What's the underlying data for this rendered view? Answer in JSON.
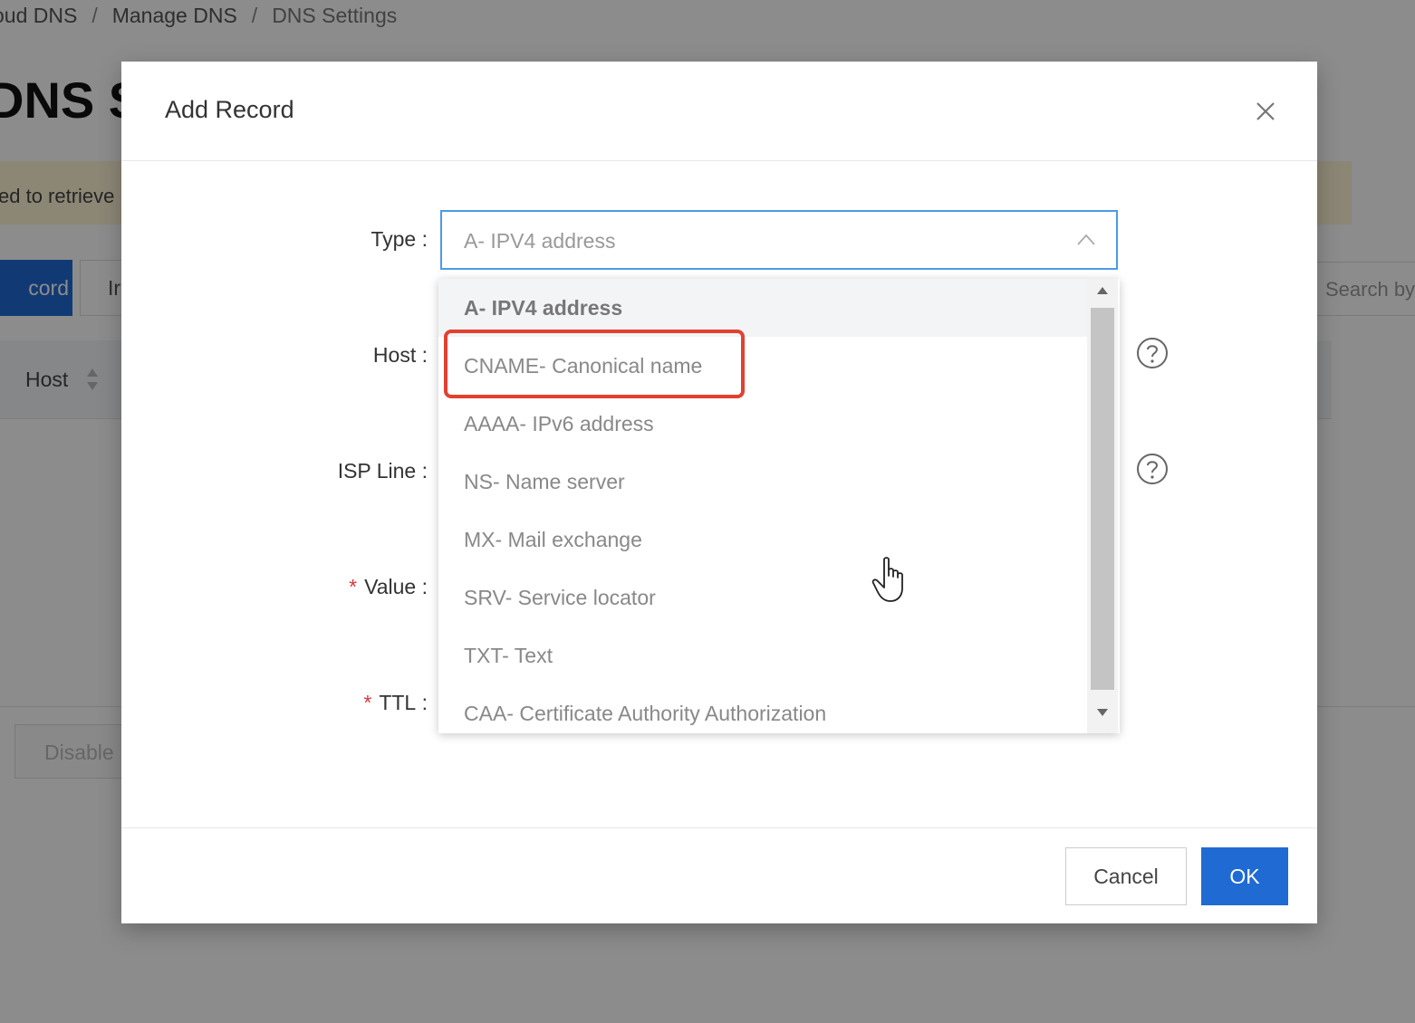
{
  "breadcrumb": {
    "item1": "oud DNS",
    "separator": "/",
    "item2": "Manage DNS",
    "item3": "DNS Settings"
  },
  "page": {
    "title": "DNS S",
    "alert_text": "ed to retrieve",
    "add_record_label": "cord",
    "second_button_label": "Ir",
    "search_placeholder": "Search by",
    "table_column_host": "Host",
    "disable_label": "Disable"
  },
  "modal": {
    "title": "Add Record",
    "labels": {
      "type": "Type :",
      "host": "Host :",
      "isp_line": "ISP Line :",
      "value": "Value :",
      "ttl": "TTL :"
    },
    "required_marker": "*",
    "type_select": {
      "value": "A- IPV4 address",
      "options": [
        "A- IPV4 address",
        "CNAME- Canonical name",
        "AAAA- IPv6 address",
        "NS- Name server",
        "MX- Mail exchange",
        "SRV- Service locator",
        "TXT- Text",
        "CAA- Certificate Authority Authorization"
      ]
    },
    "cancel_label": "Cancel",
    "ok_label": "OK"
  },
  "colors": {
    "primary": "#1f6bd3",
    "focus_border": "#4d9ae6",
    "highlight": "#e2412f",
    "required": "#d9363e"
  },
  "icons": {
    "close": "close-icon",
    "chevron": "chevron-up-icon",
    "help": "question-circle-icon",
    "sort": "sort-icon",
    "cursor": "hand-pointer-icon"
  }
}
